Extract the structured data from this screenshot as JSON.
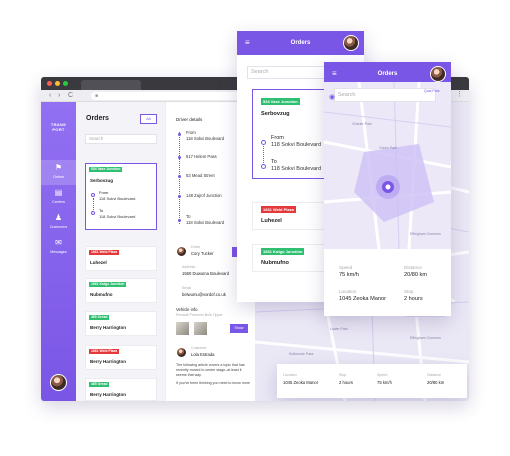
{
  "browser": {
    "nav": {
      "back": "‹",
      "forward": "›",
      "reload": "C"
    },
    "menu": "⋮",
    "brand": "TRANS PORT",
    "sidebar": [
      {
        "label": "Orders",
        "icon": "orders-icon"
      },
      {
        "label": "Carriers",
        "icon": "carriers-icon"
      },
      {
        "label": "Customers",
        "icon": "customers-icon"
      },
      {
        "label": "Messages",
        "icon": "messages-icon"
      }
    ],
    "orders": {
      "title": "Orders",
      "all_label": "All",
      "search_placeholder": "Search",
      "selected": {
        "tag": "534 Vaxe Junction",
        "name": "Serbovzug",
        "from_label": "From",
        "from_addr": "118 Sokvi Boulevard",
        "to_label": "To",
        "to_addr": "118 Sokvi Boulevard"
      },
      "items": [
        {
          "tag": "1661 Weld Plaza",
          "tag_color": "red",
          "name": "Luhezel"
        },
        {
          "tag": "1661 Kutgo Junction",
          "tag_color": "green",
          "name": "Nubmufno"
        },
        {
          "tag": "465 Oread",
          "tag_color": "green",
          "name": "Berry Harrington"
        },
        {
          "tag": "1661 Weld Plaza",
          "tag_color": "red",
          "name": "Berry Harrington"
        },
        {
          "tag": "465 Oread",
          "tag_color": "green",
          "name": "Berry Harrington"
        }
      ]
    },
    "details": {
      "title": "Driver details",
      "stops": [
        {
          "label": "From",
          "addr": "118 Sokvi Boulevard"
        },
        {
          "label": "517 Helem Pass"
        },
        {
          "label": "53 Mead Street"
        },
        {
          "label": "148 Zajrof Junction"
        },
        {
          "label": "To",
          "addr": "118 Sokvi Boulevard"
        }
      ],
      "driver_label": "Driver",
      "driver_name": "Cory Tucker",
      "address_label": "Address",
      "address_val": "1560 Duwuma Boulevard",
      "email_label": "Email",
      "email_val": "belwumu@vordof.co.uk",
      "vehicle_title": "Vehicle info",
      "vehicle_sub": "Renault Premium Bulk Tipper",
      "more_btn": "Show",
      "customer_label": "Customer",
      "customer_name": "Lola Estrada",
      "para1": "The following article covers a topic that has recently moved to center stage–at least it seems that way.",
      "para2": "If you've been thinking you need to know more"
    },
    "map_labels": [
      "Charter Park",
      "Kolbrooke Pass",
      "Lower Park",
      "Green Park",
      "Effingham Common",
      "Quai Park"
    ],
    "bottom": {
      "location_label": "Location",
      "location_val": "1045 Zeoka Manor",
      "stop_label": "Stop",
      "stop_val": "2 hours",
      "speed_label": "Speed",
      "speed_val": "75 km/h",
      "distance_label": "Distance",
      "distance_val": "20/80 km"
    }
  },
  "phone1": {
    "title": "Orders",
    "search_placeholder": "Search",
    "selected": {
      "tag": "534 Vaxe Junction",
      "name": "Serbovzug",
      "from_label": "From",
      "from_addr": "118 Sokvi Boulevard",
      "to_label": "To",
      "to_addr": "118 Sokvi Boulevard"
    },
    "items": [
      {
        "tag": "1661 Weld Plaza",
        "tag_color": "red",
        "name": "Luhezel"
      },
      {
        "tag": "1661 Kutgo Junction",
        "tag_color": "green",
        "name": "Nubmufno"
      }
    ]
  },
  "phone2": {
    "title": "Orders",
    "search_placeholder": "Search",
    "map_labels": [
      "Charter Park",
      "Green Park",
      "Effingham Common",
      "Quai Park"
    ],
    "speed_label": "Speed",
    "speed_val": "75 km/h",
    "distance_label": "Distance",
    "distance_val": "20/80 km",
    "location_label": "Location",
    "location_val": "1045 Zeoka Manor",
    "stop_label": "Stop",
    "stop_val": "2 hours"
  },
  "colors": {
    "accent": "#7a56e6",
    "green": "#2fbf71",
    "red": "#e5383b"
  }
}
